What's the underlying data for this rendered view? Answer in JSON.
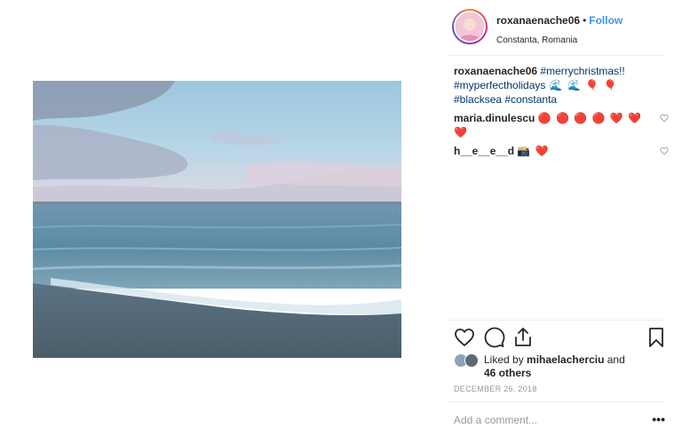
{
  "post": {
    "username": "roxanaenache06",
    "separator": "•",
    "follow_label": "Follow",
    "location": "Constanta, Romania",
    "avatar_icon": "profile-avatar"
  },
  "caption": {
    "username": "roxanaenache06",
    "tags": [
      "#merrychristmas!!",
      "#myperfectholidays",
      "#blacksea",
      "#constanta"
    ],
    "emoji_mid": "🌊 🌊 🎈 🎈"
  },
  "comments": [
    {
      "username": "maria.dinulescu",
      "text": "🔴 🔴 🔴 🔴 ❤️ ❤️ ❤️"
    },
    {
      "username": "h__e__e__d",
      "text": "📸 ❤️"
    }
  ],
  "actions": {
    "like_icon": "heart-outline-icon",
    "comment_icon": "comment-bubble-icon",
    "share_icon": "share-icon",
    "save_icon": "bookmark-icon"
  },
  "likes": {
    "prefix": "Liked by ",
    "liker": "mihaelacherciu",
    "and": " and",
    "others": "46 others"
  },
  "date": "DECEMBER 26, 2018",
  "comment_input": {
    "placeholder": "Add a comment..."
  },
  "more_label": "•••",
  "colors": {
    "follow_blue": "#3897f0",
    "hashtag_blue": "#003569",
    "muted_gray": "#999999",
    "divider": "#efefef"
  }
}
